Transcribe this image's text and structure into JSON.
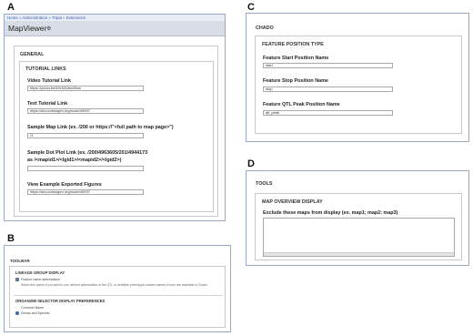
{
  "panel_labels": {
    "a": "A",
    "b": "B",
    "c": "C",
    "d": "D"
  },
  "a": {
    "breadcrumb": [
      "Home",
      "Administration",
      "Tripal",
      "Extensions"
    ],
    "title": "MapViewer",
    "general": "GENERAL",
    "tutorial_links": "TUTORIAL LINKS",
    "fields": [
      {
        "label": "Video Tutorial Link",
        "value": "https://youtu.be/kDrNDrbnvBow"
      },
      {
        "label": "Text Tutorial Link",
        "value": "https://dev.cottongen.org/node/49937"
      },
      {
        "label": "Sample Map Link (ex. /200 or https://\"<full path to map page>\")",
        "value": "/3"
      },
      {
        "label": "Sample Dot Plot Link (ex. /200/4963605/201/4944173",
        "label2": "as /<mapid1>/<lgid1>/<mapid2>/<lgid2>)",
        "value": ""
      },
      {
        "label": "View Example Exported Figures",
        "value": "https://dev.cottongen.org/node/49937"
      }
    ]
  },
  "b": {
    "toolbar": "TOOLBAR",
    "linkage": "LINKAGE GROUP DISPLAY",
    "feature_abbrev": "Feature name abbreviation",
    "feature_desc": "Select this option if you wish to use derived abbreviation of the QTL or heritable phenotypic marker names if none are available in Chado.",
    "organism": "ORGANISM SELECTOR DISPLAY PREFERENCES",
    "opt1": "Common Name",
    "opt2": "Genus and Species"
  },
  "c": {
    "chado": "CHADO",
    "fpt": "FEATURE POSITION TYPE",
    "fields": [
      {
        "label": "Feature Start Position Name",
        "value": "start"
      },
      {
        "label": "Feature Stop Position Name",
        "value": "stop"
      },
      {
        "label": "Feature QTL Peak Position Name",
        "value": "qtl_peak"
      }
    ]
  },
  "d": {
    "tools": "TOOLS",
    "overview": "MAP OVERVIEW DISPLAY",
    "exclude": "Exclude these maps from display (ex. map1; map2; map3)"
  }
}
